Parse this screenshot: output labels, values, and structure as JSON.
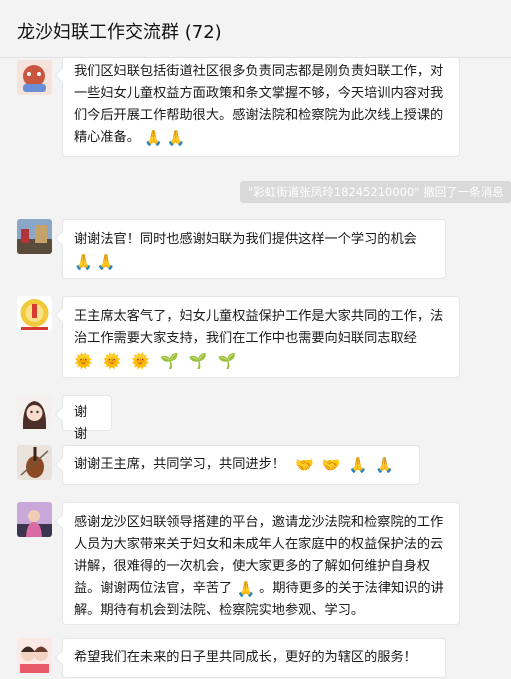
{
  "header": {
    "title": "龙沙妇联工作交流群 (72)"
  },
  "system_notice": "\"彩虹街道张凤玲18245210000\" 撤回了一条消息",
  "messages": [
    {
      "text": "我们区妇联包括街道社区很多负责同志都是刚负责妇联工作，对一些妇女儿童权益方面政策和条文掌握不够，今天培训内容对我们今后开展工作帮助很大。感谢法院和检察院为此次线上授课的精心准备。",
      "emojis": [
        "🙏",
        "🙏"
      ]
    },
    {
      "text": "谢谢法官！同时也感谢妇联为我们提供这样一个学习的机会",
      "emojis": [
        "🙏",
        "🙏"
      ]
    },
    {
      "text": "王主席太客气了，妇女儿童权益保护工作是大家共同的工作，法治工作需要大家支持，我们在工作中也需要向妇联同志取经",
      "emojis": [
        "🌞",
        "🌞",
        "🌞",
        "🌱",
        "🌱",
        "🌱"
      ]
    },
    {
      "text": "谢谢",
      "emojis": []
    },
    {
      "text": "谢谢王主席，共同学习，共同进步！",
      "emojis": [
        "🤝",
        "🤝",
        "🙏",
        "🙏"
      ]
    },
    {
      "text_before": "感谢龙沙区妇联领导搭建的平台，邀请龙沙法院和检察院的工作人员为大家带来关于妇女和未成年人在家庭中的权益保护法的云讲解，很难得的一次机会，使大家更多的了解如何维护自身权益。谢谢两位法官，辛苦了",
      "emoji_inline": "🙏",
      "text_after": "。期待更多的关于法律知识的讲解。期待有机会到法院、检察院实地参观、学习。"
    },
    {
      "text": "希望我们在未来的日子里共同成长，更好的为辖区的服务！",
      "emojis": []
    }
  ],
  "avatars": [
    "avatar-mascot-icon",
    "avatar-landscape-icon",
    "avatar-emblem-icon",
    "avatar-girl-icon",
    "avatar-violin-icon",
    "avatar-woman-icon",
    "avatar-couple-icon"
  ]
}
